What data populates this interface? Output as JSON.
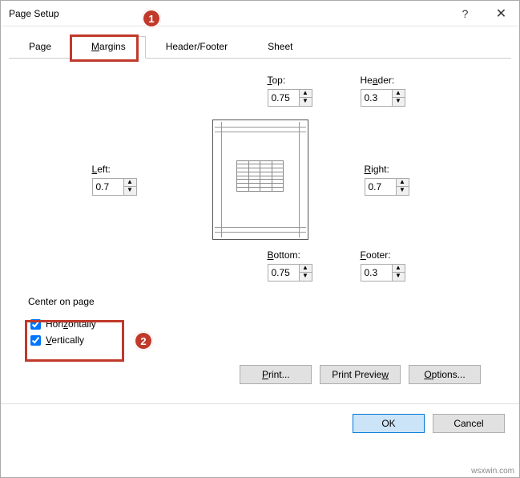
{
  "window": {
    "title": "Page Setup"
  },
  "tabs": {
    "page": "Page",
    "margins": "Margins",
    "headerfooter": "Header/Footer",
    "sheet": "Sheet"
  },
  "margins": {
    "top_label": "Top:",
    "top_value": "0.75",
    "header_label": "Header:",
    "header_value": "0.3",
    "left_label": "Left:",
    "left_value": "0.7",
    "right_label": "Right:",
    "right_value": "0.7",
    "bottom_label": "Bottom:",
    "bottom_value": "0.75",
    "footer_label": "Footer:",
    "footer_value": "0.3"
  },
  "center": {
    "section": "Center on page",
    "horizontally": "Horizontally",
    "vertically": "Vertically"
  },
  "buttons": {
    "print": "Print...",
    "preview": "Print Preview",
    "options": "Options...",
    "ok": "OK",
    "cancel": "Cancel"
  },
  "callouts": {
    "one": "1",
    "two": "2"
  },
  "watermark": "wsxwin.com"
}
